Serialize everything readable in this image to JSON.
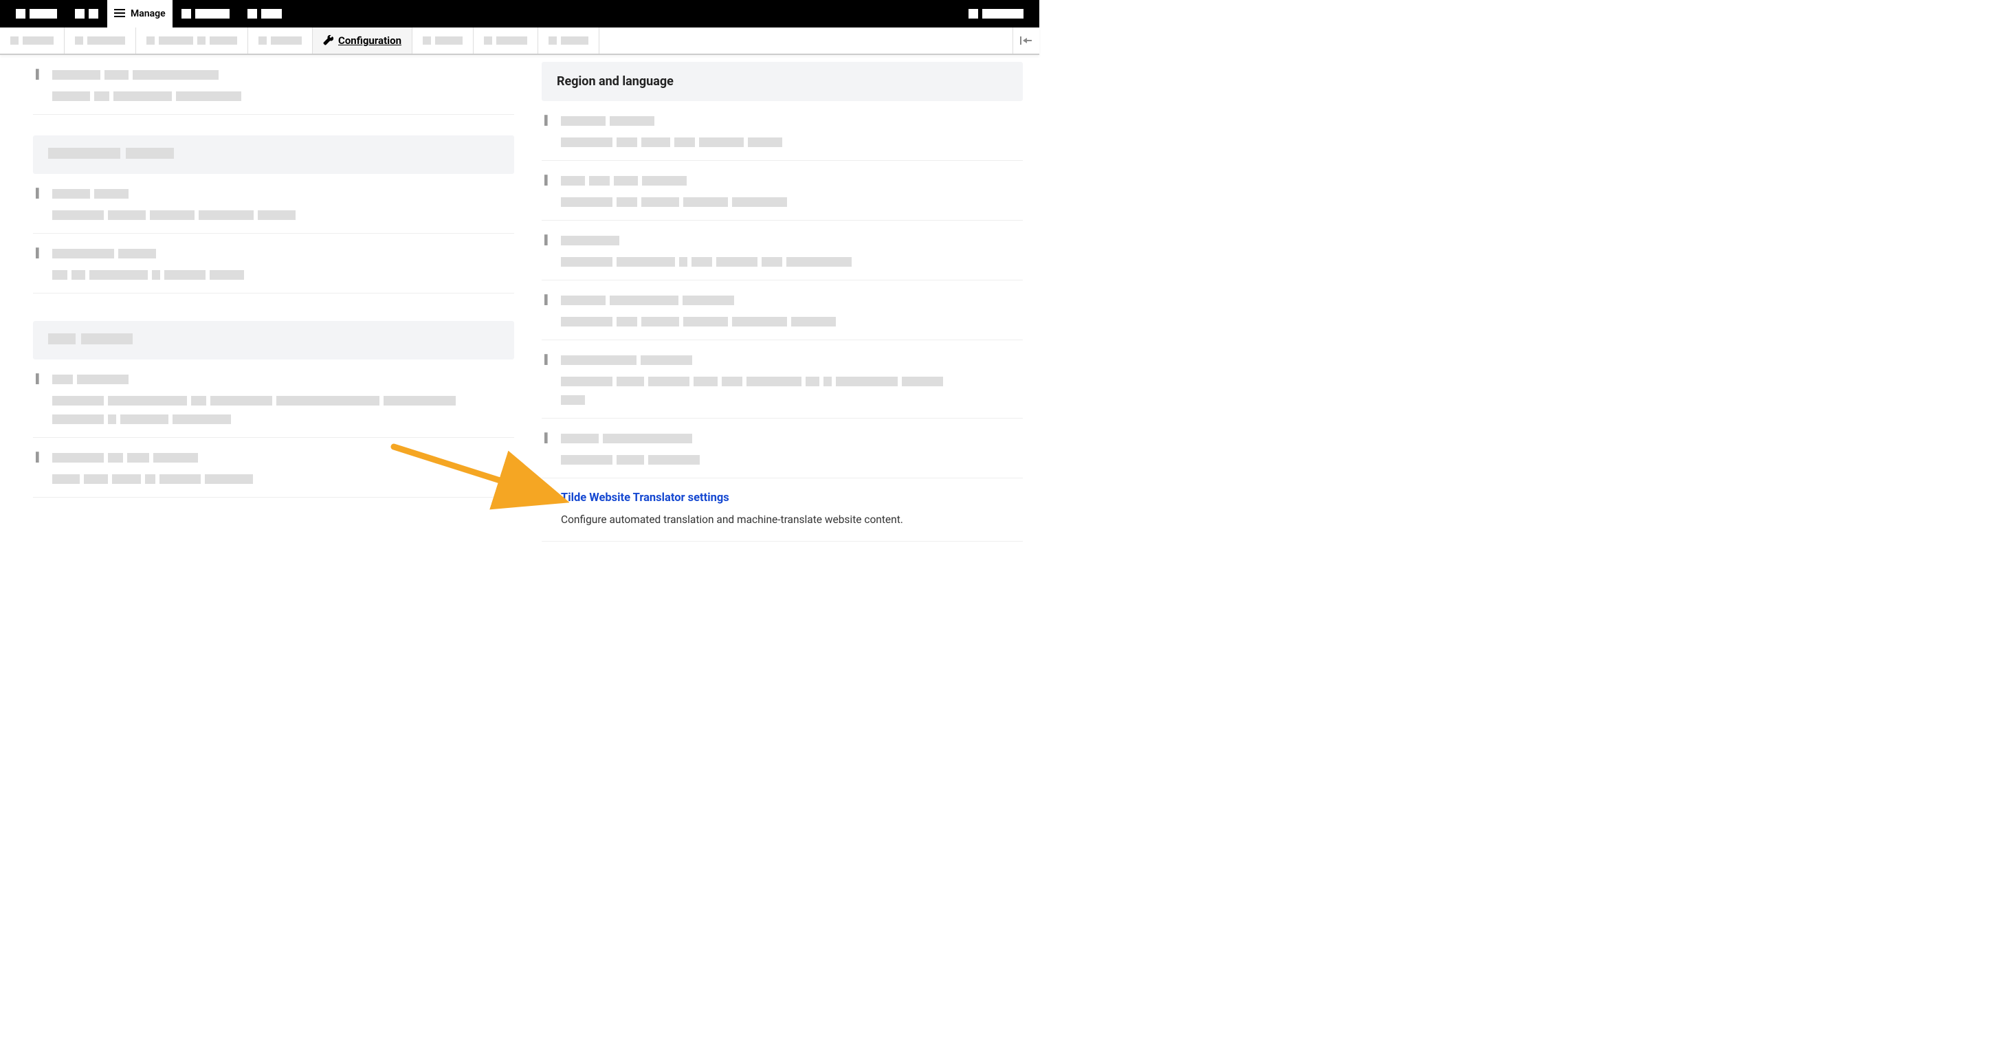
{
  "topbar": {
    "manage_label": "Manage"
  },
  "navbar2": {
    "configuration_label": "Configuration"
  },
  "right_column": {
    "section_title": "Region and language",
    "tilde_item": {
      "title": "Tilde Website Translator settings",
      "description": "Configure automated translation and machine-translate website content."
    }
  }
}
